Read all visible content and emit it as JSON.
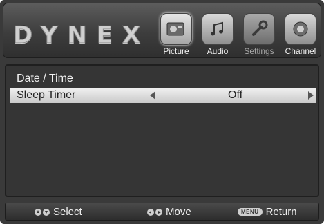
{
  "header": {
    "brand": "DYNEX",
    "tabs": [
      {
        "label": "Picture",
        "icon": "picture-icon",
        "state": "active"
      },
      {
        "label": "Audio",
        "icon": "audio-icon",
        "state": "normal"
      },
      {
        "label": "Settings",
        "icon": "settings-icon",
        "state": "dim"
      },
      {
        "label": "Channel",
        "icon": "channel-icon",
        "state": "normal"
      }
    ]
  },
  "menu": {
    "items": [
      {
        "label": "Date / Time",
        "value": ""
      },
      {
        "label": "Sleep Timer",
        "value": "Off"
      }
    ]
  },
  "footer": {
    "select_label": "Select",
    "move_label": "Move",
    "menu_button": "MENU",
    "return_label": "Return"
  },
  "colors": {
    "background": "#353535",
    "highlight": "#d9d9d9",
    "text": "#f2f2f2"
  }
}
